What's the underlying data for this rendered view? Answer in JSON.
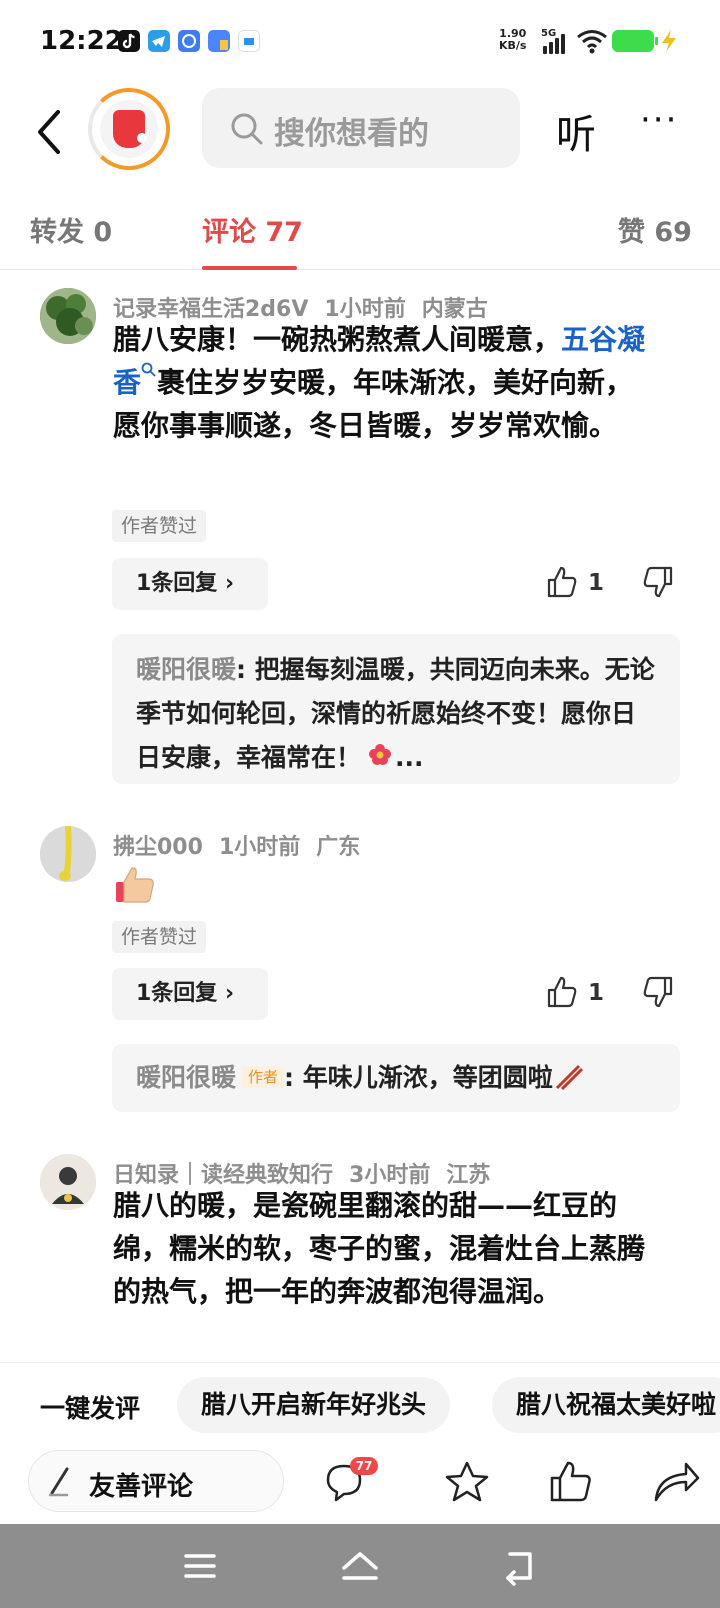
{
  "status_bar": {
    "time": "12:22",
    "net_speed_value": "1.90",
    "net_speed_unit": "KB/s",
    "signal_label": "5G",
    "app_icons": [
      "tiktok-icon",
      "telegram-icon",
      "message-icon",
      "file-icon",
      "app-icon"
    ],
    "colors": {
      "battery": "#3ddc4a",
      "bolt": "#f0c020"
    }
  },
  "header": {
    "search_placeholder": "搜你想看的",
    "listen_label": "听",
    "more_label": "···"
  },
  "tabs": {
    "repost": "转发 0",
    "comments": "评论 77",
    "likes": "赞 69",
    "active_color": "#e24a4a"
  },
  "comments": [
    {
      "user": "记录幸福生活2d6V",
      "time": "1小时前",
      "location": "内蒙古",
      "text_before": "腊八安康！一碗热粥熬煮人间暖意，",
      "link": "五谷凝香",
      "text_after": "裹住岁岁安暖，年味渐浓，美好向新，愿你事事顺遂，冬日皆暖，岁岁常欢愉。",
      "author_liked": "作者赞过",
      "reply_label": "1条回复",
      "like_count": "1",
      "reply": {
        "name": "暖阳很暖",
        "separator": ":",
        "text": " 把握每刻温暖，共同迈向未来。无论季节如何轮回，深情的祈愿始终不变！愿你日日安康，幸福常在！",
        "ellipsis": "..."
      }
    },
    {
      "user": "拂尘000",
      "time": "1小时前",
      "location": "广东",
      "author_liked": "作者赞过",
      "reply_label": "1条回复",
      "like_count": "1",
      "reply": {
        "name": "暖阳很暖",
        "tag": "作者",
        "separator": ":",
        "text": " 年味儿渐浓，等团圆啦"
      }
    },
    {
      "user": "日知录｜读经典致知行",
      "time": "3小时前",
      "location": "江苏",
      "text": "腊八的暖，是瓷碗里翻滚的甜——红豆的绵，糯米的软，枣子的蜜，混着灶台上蒸腾的热气，把一年的奔波都泡得温润。"
    }
  ],
  "quick_comments": {
    "label": "一键发评",
    "chips": [
      "腊八开启新年好兆头",
      "腊八祝福太美好啦"
    ]
  },
  "toolbar": {
    "input_label": "友善评论",
    "comment_badge": "77"
  }
}
